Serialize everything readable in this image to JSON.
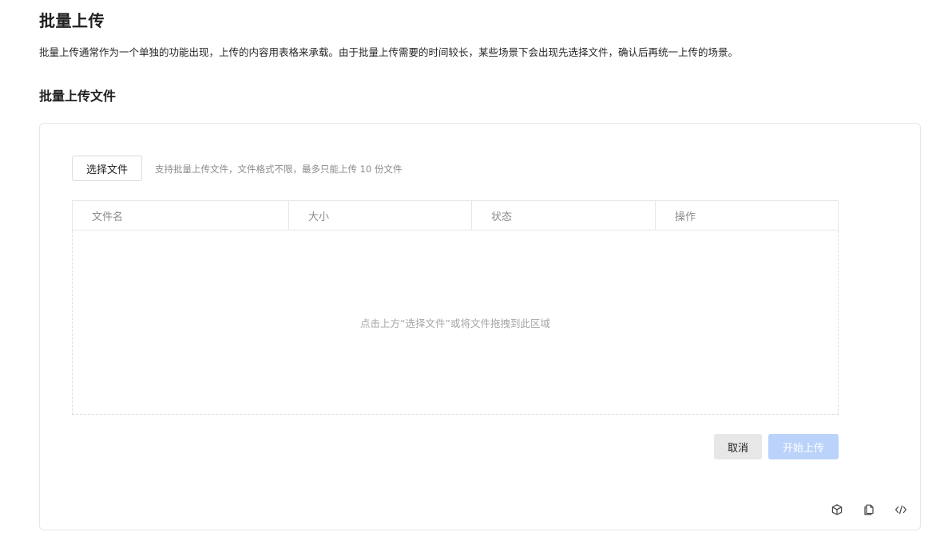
{
  "page": {
    "title": "批量上传",
    "description": "批量上传通常作为一个单独的功能出现，上传的内容用表格来承载。由于批量上传需要的时间较长，某些场景下会出现先选择文件，确认后再统一上传的场景。"
  },
  "section": {
    "title": "批量上传文件"
  },
  "uploader": {
    "select_label": "选择文件",
    "tip": "支持批量上传文件，文件格式不限，最多只能上传 10 份文件",
    "columns": [
      "文件名",
      "大小",
      "状态",
      "操作"
    ],
    "empty_text": "点击上方“选择文件”或将文件拖拽到此区域",
    "cancel_label": "取消",
    "start_label": "开始上传"
  },
  "toolbar": {
    "icons": [
      "cube-icon",
      "copy-icon",
      "code-icon"
    ]
  },
  "colors": {
    "primary_disabled": "#bbd3fb",
    "border": "#e7e7e7",
    "muted_text": "#8b8b8b"
  }
}
